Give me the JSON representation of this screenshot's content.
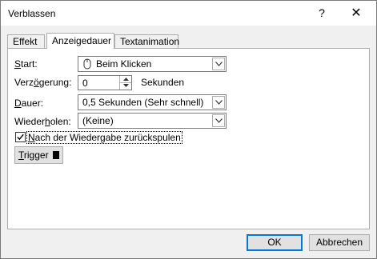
{
  "window": {
    "title": "Verblassen",
    "help_glyph": "?",
    "close_glyph": "✕"
  },
  "tabs": [
    {
      "label": "Effekt"
    },
    {
      "label": "Anzeigedauer",
      "active": true
    },
    {
      "label": "Textanimation"
    }
  ],
  "form": {
    "start": {
      "label_u": "S",
      "label_rest": "tart:",
      "value": "Beim Klicken"
    },
    "delay": {
      "label_pre": "Verz",
      "label_u": "ö",
      "label_rest": "gerung:",
      "value": "0",
      "unit": "Sekunden"
    },
    "duration": {
      "label_u": "D",
      "label_rest": "auer:",
      "value": "0,5 Sekunden (Sehr schnell)"
    },
    "repeat": {
      "label_pre": "Wieder",
      "label_u": "h",
      "label_rest": "olen:",
      "value": "(Keine)"
    },
    "rewind": {
      "label_pre": "",
      "label_u": "N",
      "label_rest": "ach der Wiedergabe zurückspulen",
      "checked": true
    },
    "trigger": {
      "label_u": "T",
      "label_rest": "rigger"
    }
  },
  "footer": {
    "ok_label": "OK",
    "cancel_label": "Abbrechen"
  },
  "icons": [
    "mouse-icon",
    "chevron-down-icon",
    "spin-up-icon",
    "spin-down-icon",
    "checkmark-icon",
    "close-icon",
    "help-icon"
  ]
}
